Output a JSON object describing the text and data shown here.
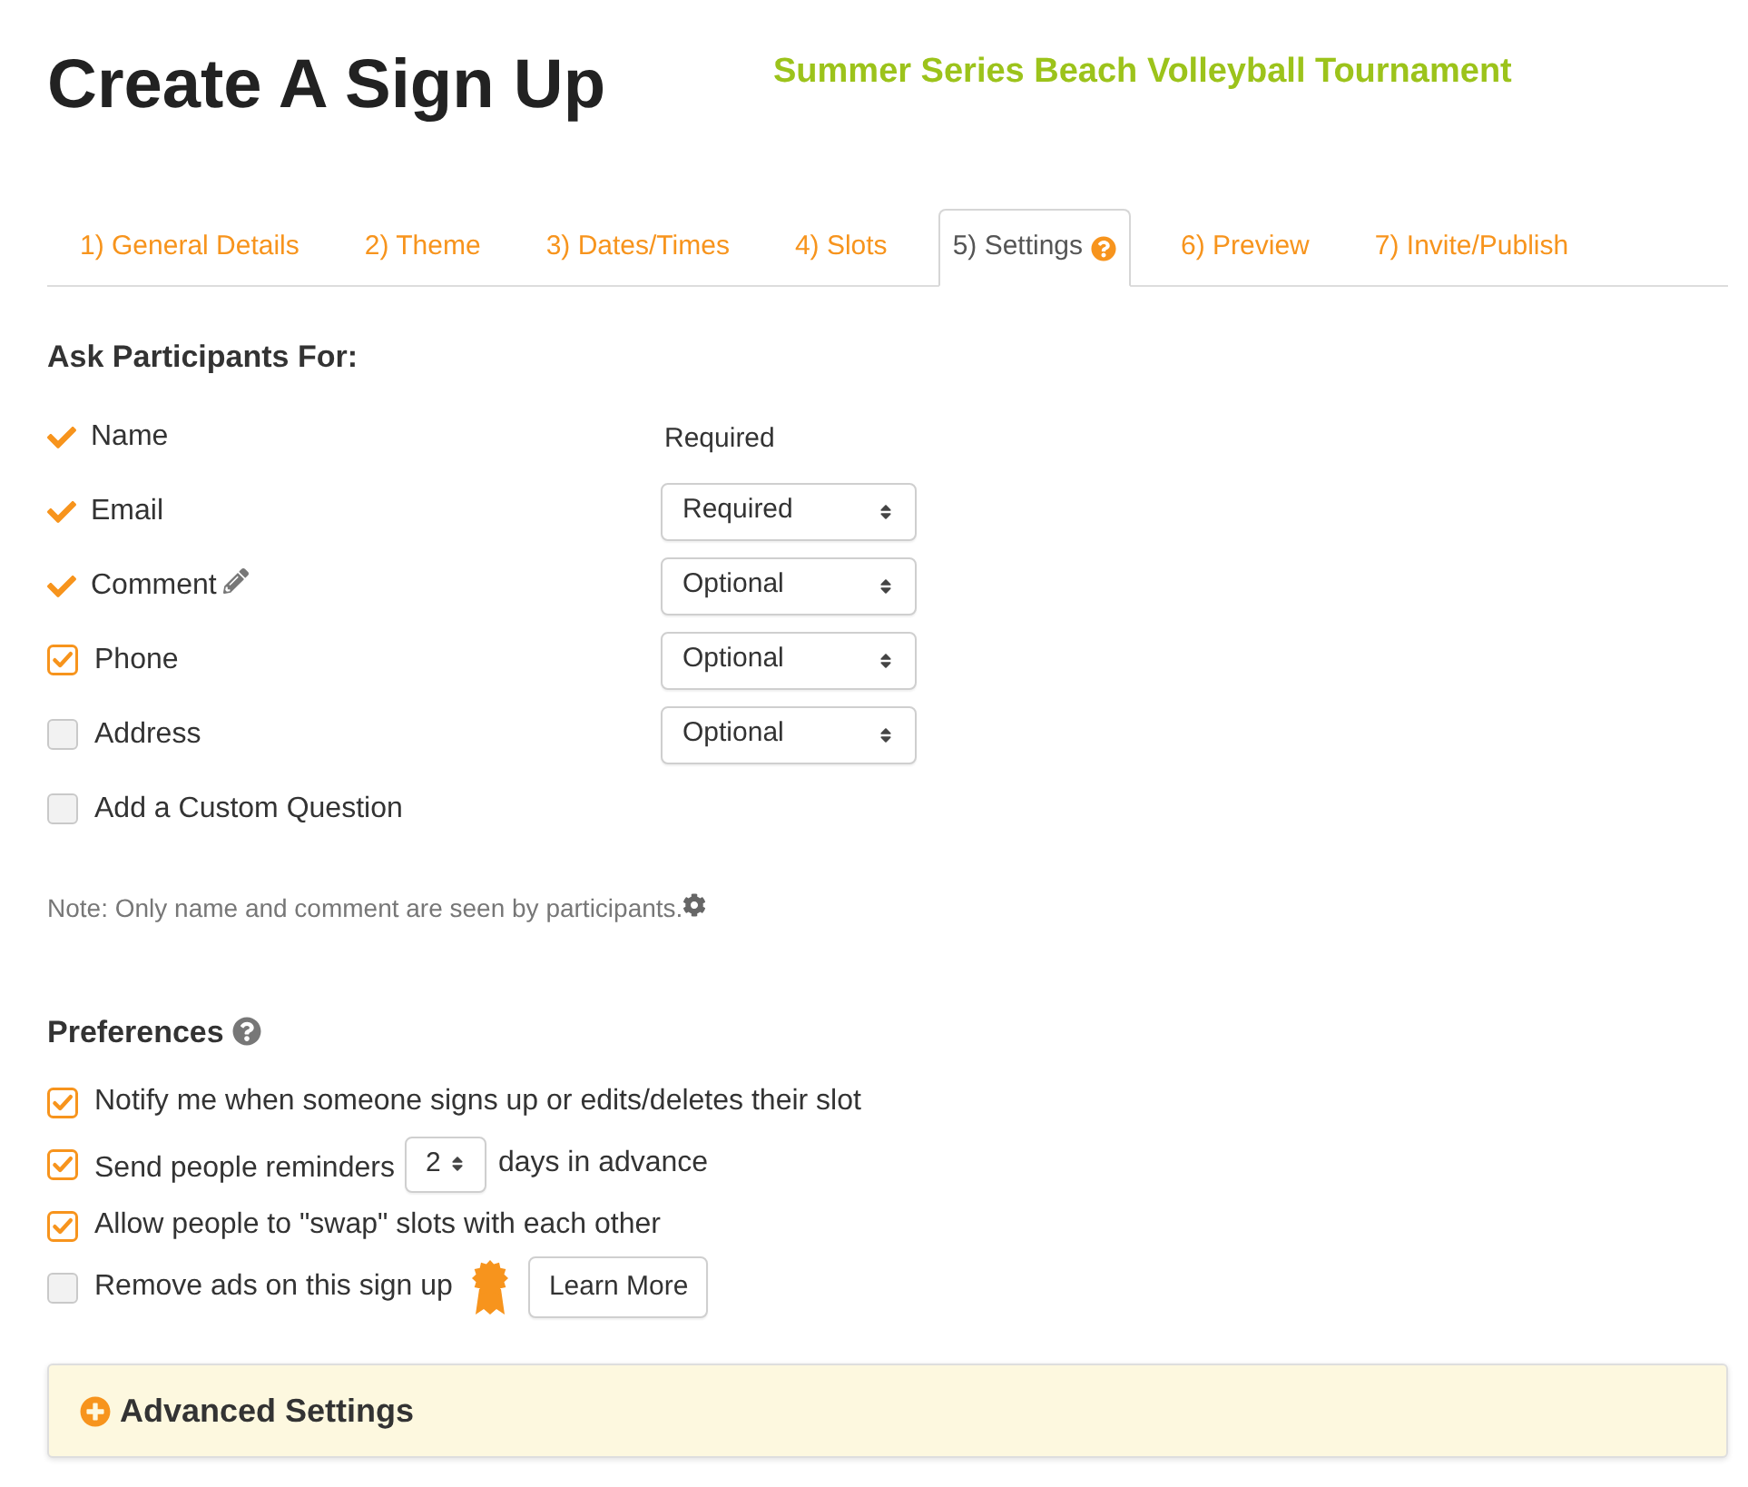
{
  "header": {
    "title": "Create A Sign Up",
    "event_title": "Summer Series Beach Volleyball Tournament"
  },
  "tabs": [
    {
      "label": "1) General Details",
      "selected": false,
      "help": false
    },
    {
      "label": "2) Theme",
      "selected": false,
      "help": false
    },
    {
      "label": "3) Dates/Times",
      "selected": false,
      "help": false
    },
    {
      "label": "4) Slots",
      "selected": false,
      "help": false
    },
    {
      "label": "5) Settings",
      "selected": true,
      "help": true
    },
    {
      "label": "6) Preview",
      "selected": false,
      "help": false
    },
    {
      "label": "7) Invite/Publish",
      "selected": false,
      "help": false
    }
  ],
  "participant_fields": {
    "heading": "Ask Participants For:",
    "items": [
      {
        "label": "Name",
        "kind": "fixed",
        "editable": false,
        "requirement": {
          "kind": "text",
          "value": "Required"
        }
      },
      {
        "label": "Email",
        "kind": "fixed",
        "editable": false,
        "requirement": {
          "kind": "select",
          "value": "Required"
        }
      },
      {
        "label": "Comment",
        "kind": "fixed",
        "editable": true,
        "requirement": {
          "kind": "select",
          "value": "Optional"
        }
      },
      {
        "label": "Phone",
        "kind": "checkbox",
        "checked": true,
        "editable": false,
        "requirement": {
          "kind": "select",
          "value": "Optional"
        }
      },
      {
        "label": "Address",
        "kind": "checkbox",
        "checked": false,
        "editable": false,
        "requirement": {
          "kind": "select",
          "value": "Optional"
        }
      },
      {
        "label": "Add a Custom Question",
        "kind": "checkbox",
        "checked": false,
        "editable": false
      }
    ]
  },
  "note": "Note: Only name and comment are seen by participants.",
  "preferences": {
    "heading": "Preferences",
    "items": [
      {
        "kind": "plain",
        "label": "Notify me when someone signs up or edits/deletes their slot",
        "checked": true
      },
      {
        "kind": "reminder",
        "label": "Send people reminders",
        "checked": true,
        "days": "2",
        "suffix": "days in advance"
      },
      {
        "kind": "plain",
        "label": "Allow people to \"swap\" slots with each other",
        "checked": true
      },
      {
        "kind": "upgrade",
        "label": "Remove ads on this sign up",
        "checked": false,
        "button": "Learn More"
      }
    ]
  },
  "advanced_settings": {
    "label": "Advanced Settings",
    "expanded": false
  }
}
